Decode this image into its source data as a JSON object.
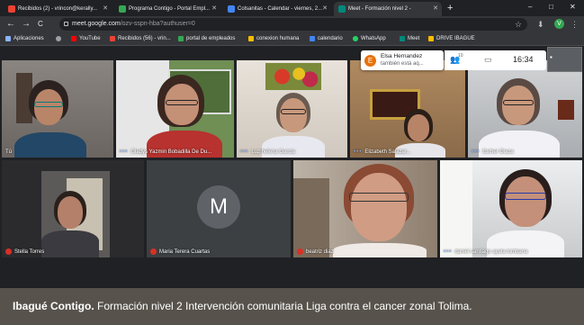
{
  "browser": {
    "tabs": [
      {
        "label": "Recibidos (2) - vrincon@kerally...",
        "favicon_color": "#ea4335",
        "active": false
      },
      {
        "label": "Programa Contigo - Portal Empl...",
        "favicon_color": "#34a853",
        "active": false
      },
      {
        "label": "Colsanitas - Calendar - viernes, 2...",
        "favicon_color": "#4285f4",
        "active": false
      },
      {
        "label": "Meet - Formación nivel 2 -",
        "favicon_color": "#00897b",
        "active": true
      }
    ],
    "new_tab": "+",
    "window_controls": [
      "–",
      "□",
      "✕"
    ],
    "nav": [
      "←",
      "→",
      "C"
    ],
    "url": {
      "host": "meet.google.com",
      "path": "/ozv-sspn-hba?authuser=0"
    },
    "toolbar_icons": [
      "☆",
      "⬇"
    ],
    "profile_initial": "V",
    "bookmarks": [
      {
        "label": "Aplicaciones",
        "color": "#8ab4f8"
      },
      {
        "label": "",
        "color": "#9aa0a6"
      },
      {
        "label": "YouTube",
        "color": "#ff0000"
      },
      {
        "label": "Recibidos (56) - vrin...",
        "color": "#ea4335"
      },
      {
        "label": "portal de empleados",
        "color": "#34a853"
      },
      {
        "label": "conexion humana",
        "color": "#fbbc04"
      },
      {
        "label": "calendario",
        "color": "#4285f4"
      },
      {
        "label": "WhatsApp",
        "color": "#25d366"
      },
      {
        "label": "Meet",
        "color": "#00897b"
      },
      {
        "label": "DRIVE IBAGUE",
        "color": "#fbbc04"
      }
    ]
  },
  "meet": {
    "participants": [
      {
        "name": "Tú",
        "muted": false
      },
      {
        "name": "Gladys Yazmin Bobadilla De Du...",
        "muted": false
      },
      {
        "name": "Luz helena Garcia",
        "muted": false
      },
      {
        "name": "Elizabeth Salazar...",
        "muted": false
      },
      {
        "name": "Esther Diaza",
        "muted": false
      },
      {
        "name": "Stella Torres",
        "muted": true
      },
      {
        "name": "Maria Terera Cuartas",
        "muted": true,
        "avatar_initial": "M"
      },
      {
        "name": "beatriz diaz",
        "muted": true
      },
      {
        "name": "daniel santiago ayala lombana",
        "muted": false
      }
    ],
    "notification": {
      "initial": "E",
      "line1": "Elsa Hernandez",
      "line2": "también está aq..."
    },
    "participant_count": "10",
    "clock": "16:34"
  },
  "caption": {
    "bold": "Ibagué Contigo.",
    "text": " Formación nivel 2 Intervención comunitaria Liga contra el cancer zonal Tolima."
  }
}
